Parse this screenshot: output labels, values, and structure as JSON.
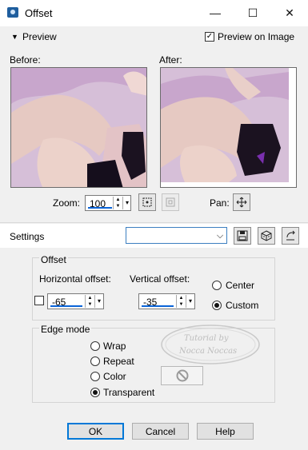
{
  "window": {
    "title": "Offset",
    "minimize_glyph": "—",
    "maximize_glyph": "☐",
    "close_glyph": "✕"
  },
  "preview_bar": {
    "toggle_label": "Preview",
    "preview_on_image_label": "Preview on Image",
    "preview_on_image_checked": true
  },
  "before": {
    "label": "Before:"
  },
  "after": {
    "label": "After:"
  },
  "zoom": {
    "label": "Zoom:",
    "value": "100"
  },
  "pan": {
    "label": "Pan:"
  },
  "settings": {
    "label": "Settings",
    "value": ""
  },
  "offset": {
    "legend": "Offset",
    "horizontal_label": "Horizontal offset:",
    "horizontal_value": "-65",
    "vertical_label": "Vertical offset:",
    "vertical_value": "-35",
    "link_checked": false,
    "center_label": "Center",
    "custom_label": "Custom",
    "selected": "Custom"
  },
  "edge_mode": {
    "legend": "Edge mode",
    "options": [
      "Wrap",
      "Repeat",
      "Color",
      "Transparent"
    ],
    "selected": "Transparent"
  },
  "watermark": {
    "line1": "Tutorial by",
    "line2": "Nocca Noccas"
  },
  "buttons": {
    "ok": "OK",
    "cancel": "Cancel",
    "help": "Help"
  },
  "colors": {
    "accent": "#0078d7",
    "photo_tone": "#cfb7cf"
  },
  "icons": {
    "app": "app-icon",
    "zoom_fit": "zoom-fit-icon",
    "zoom_actual": "zoom-actual-icon",
    "pan": "pan-move-icon",
    "save_preset": "save-icon",
    "reset_preset": "dice-icon",
    "random": "reset-icon",
    "color_swatch": "no-color-icon"
  }
}
